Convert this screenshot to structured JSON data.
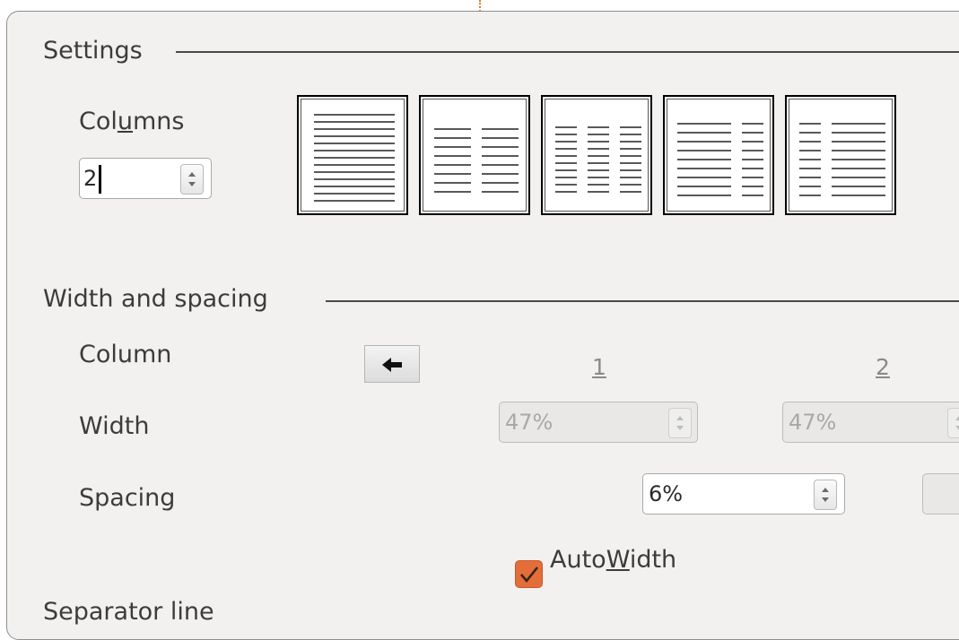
{
  "settings": {
    "title": "Settings",
    "columns_label_pre": "Col",
    "columns_label_mnemonic": "u",
    "columns_label_post": "mns",
    "columns_value": "2",
    "presets": [
      "1 column",
      "2 columns",
      "3 columns",
      "2 columns, left larger",
      "2 columns, right larger"
    ]
  },
  "width_spacing": {
    "title": "Width and spacing",
    "column_label": "Column",
    "width_label": "Width",
    "spacing_label": "Spacing",
    "col1_header": "1",
    "col2_header": "2",
    "width1": "47%",
    "width2": "47%",
    "spacing1": "6%",
    "autowidth_pre": "Auto",
    "autowidth_mnemonic": "W",
    "autowidth_post": "idth",
    "autowidth_checked": true
  },
  "separator": {
    "title": "Separator line"
  },
  "colors": {
    "accent": "#e36e3a",
    "panel": "#f2f1f0"
  }
}
